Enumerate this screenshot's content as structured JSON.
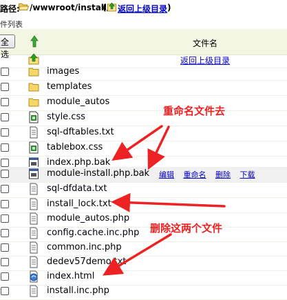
{
  "path_bar": {
    "prefix": "路径:",
    "path": "/wwwroot/install/",
    "paren_open": "(",
    "back_link": "返回上级目录",
    "paren_close": ")"
  },
  "list_title": "件列表",
  "header": {
    "select_all": "全选",
    "column_filename": "文件名"
  },
  "rows": [
    {
      "type": "parent",
      "name": "返回上级目录",
      "icon": "folder-up-icon"
    },
    {
      "type": "folder",
      "name": "images",
      "icon": "folder-icon"
    },
    {
      "type": "folder",
      "name": "templates",
      "icon": "folder-icon"
    },
    {
      "type": "folder",
      "name": "module_autos",
      "icon": "folder-icon"
    },
    {
      "type": "file",
      "name": "style.css",
      "icon": "css-file-icon"
    },
    {
      "type": "file",
      "name": "sql-dftables.txt",
      "icon": "text-file-icon"
    },
    {
      "type": "file",
      "name": "tablebox.css",
      "icon": "css-file-icon"
    },
    {
      "type": "file",
      "name": "index.php.bak",
      "icon": "bak-file-icon"
    },
    {
      "type": "file",
      "name": "module-install.php.bak",
      "icon": "bak-file-icon",
      "highlighted": true,
      "actions": [
        "编辑",
        "重命名",
        "删除",
        "下载"
      ]
    },
    {
      "type": "file",
      "name": "sql-dfdata.txt",
      "icon": "text-file-icon"
    },
    {
      "type": "file",
      "name": "install_lock.txt",
      "icon": "text-file-icon"
    },
    {
      "type": "file",
      "name": "module_autos.php",
      "icon": "text-file-icon"
    },
    {
      "type": "file",
      "name": "config.cache.inc.php",
      "icon": "text-file-icon"
    },
    {
      "type": "file",
      "name": "common.inc.php",
      "icon": "text-file-icon"
    },
    {
      "type": "file",
      "name": "dedev57demo.txt",
      "icon": "text-file-icon"
    },
    {
      "type": "file",
      "name": "index.html",
      "icon": "html-file-icon"
    },
    {
      "type": "file",
      "name": "install.inc.php",
      "icon": "text-file-icon"
    }
  ],
  "annotations": {
    "rename_note": "重命名文件去",
    "delete_note": "删除这两个文件",
    "color": "#ee2222"
  }
}
